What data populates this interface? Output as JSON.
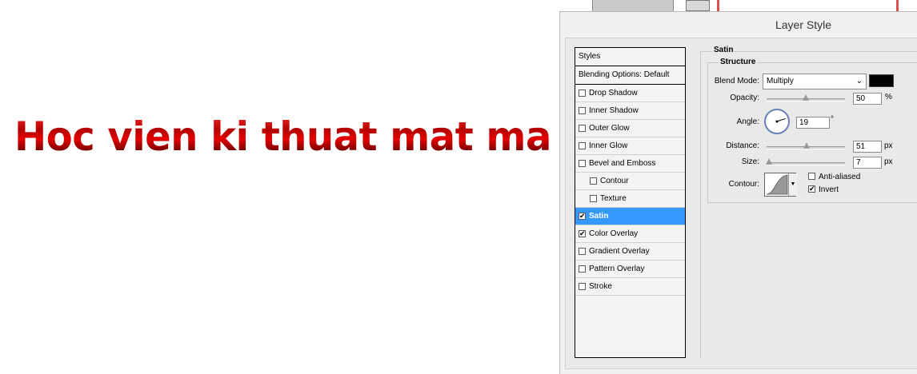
{
  "canvas": {
    "text": "Hoc vien ki thuat mat ma"
  },
  "dialog": {
    "title": "Layer Style",
    "styles_header": "Styles",
    "blending_options": "Blending Options: Default",
    "styles": [
      {
        "label": "Drop Shadow",
        "checked": false,
        "sub": false,
        "selected": false
      },
      {
        "label": "Inner Shadow",
        "checked": false,
        "sub": false,
        "selected": false
      },
      {
        "label": "Outer Glow",
        "checked": false,
        "sub": false,
        "selected": false
      },
      {
        "label": "Inner Glow",
        "checked": false,
        "sub": false,
        "selected": false
      },
      {
        "label": "Bevel and Emboss",
        "checked": false,
        "sub": false,
        "selected": false
      },
      {
        "label": "Contour",
        "checked": false,
        "sub": true,
        "selected": false
      },
      {
        "label": "Texture",
        "checked": false,
        "sub": true,
        "selected": false
      },
      {
        "label": "Satin",
        "checked": true,
        "sub": false,
        "selected": true
      },
      {
        "label": "Color Overlay",
        "checked": true,
        "sub": false,
        "selected": false
      },
      {
        "label": "Gradient Overlay",
        "checked": false,
        "sub": false,
        "selected": false
      },
      {
        "label": "Pattern Overlay",
        "checked": false,
        "sub": false,
        "selected": false
      },
      {
        "label": "Stroke",
        "checked": false,
        "sub": false,
        "selected": false
      }
    ],
    "satin": {
      "group_title": "Satin",
      "structure_title": "Structure",
      "blend_mode_label": "Blend Mode:",
      "blend_mode_value": "Multiply",
      "blend_color": "#000000",
      "opacity_label": "Opacity:",
      "opacity_value": "50",
      "opacity_unit": "%",
      "opacity_fraction": 0.5,
      "angle_label": "Angle:",
      "angle_value": "19",
      "angle_unit": "°",
      "distance_label": "Distance:",
      "distance_value": "51",
      "distance_unit": "px",
      "distance_fraction": 0.51,
      "size_label": "Size:",
      "size_value": "7",
      "size_unit": "px",
      "size_fraction": 0.03,
      "contour_label": "Contour:",
      "anti_aliased_label": "Anti-aliased",
      "anti_aliased_checked": false,
      "invert_label": "Invert",
      "invert_checked": true
    }
  },
  "colors": {
    "selected_bg": "#3399ff",
    "text_red": "#c00000"
  }
}
